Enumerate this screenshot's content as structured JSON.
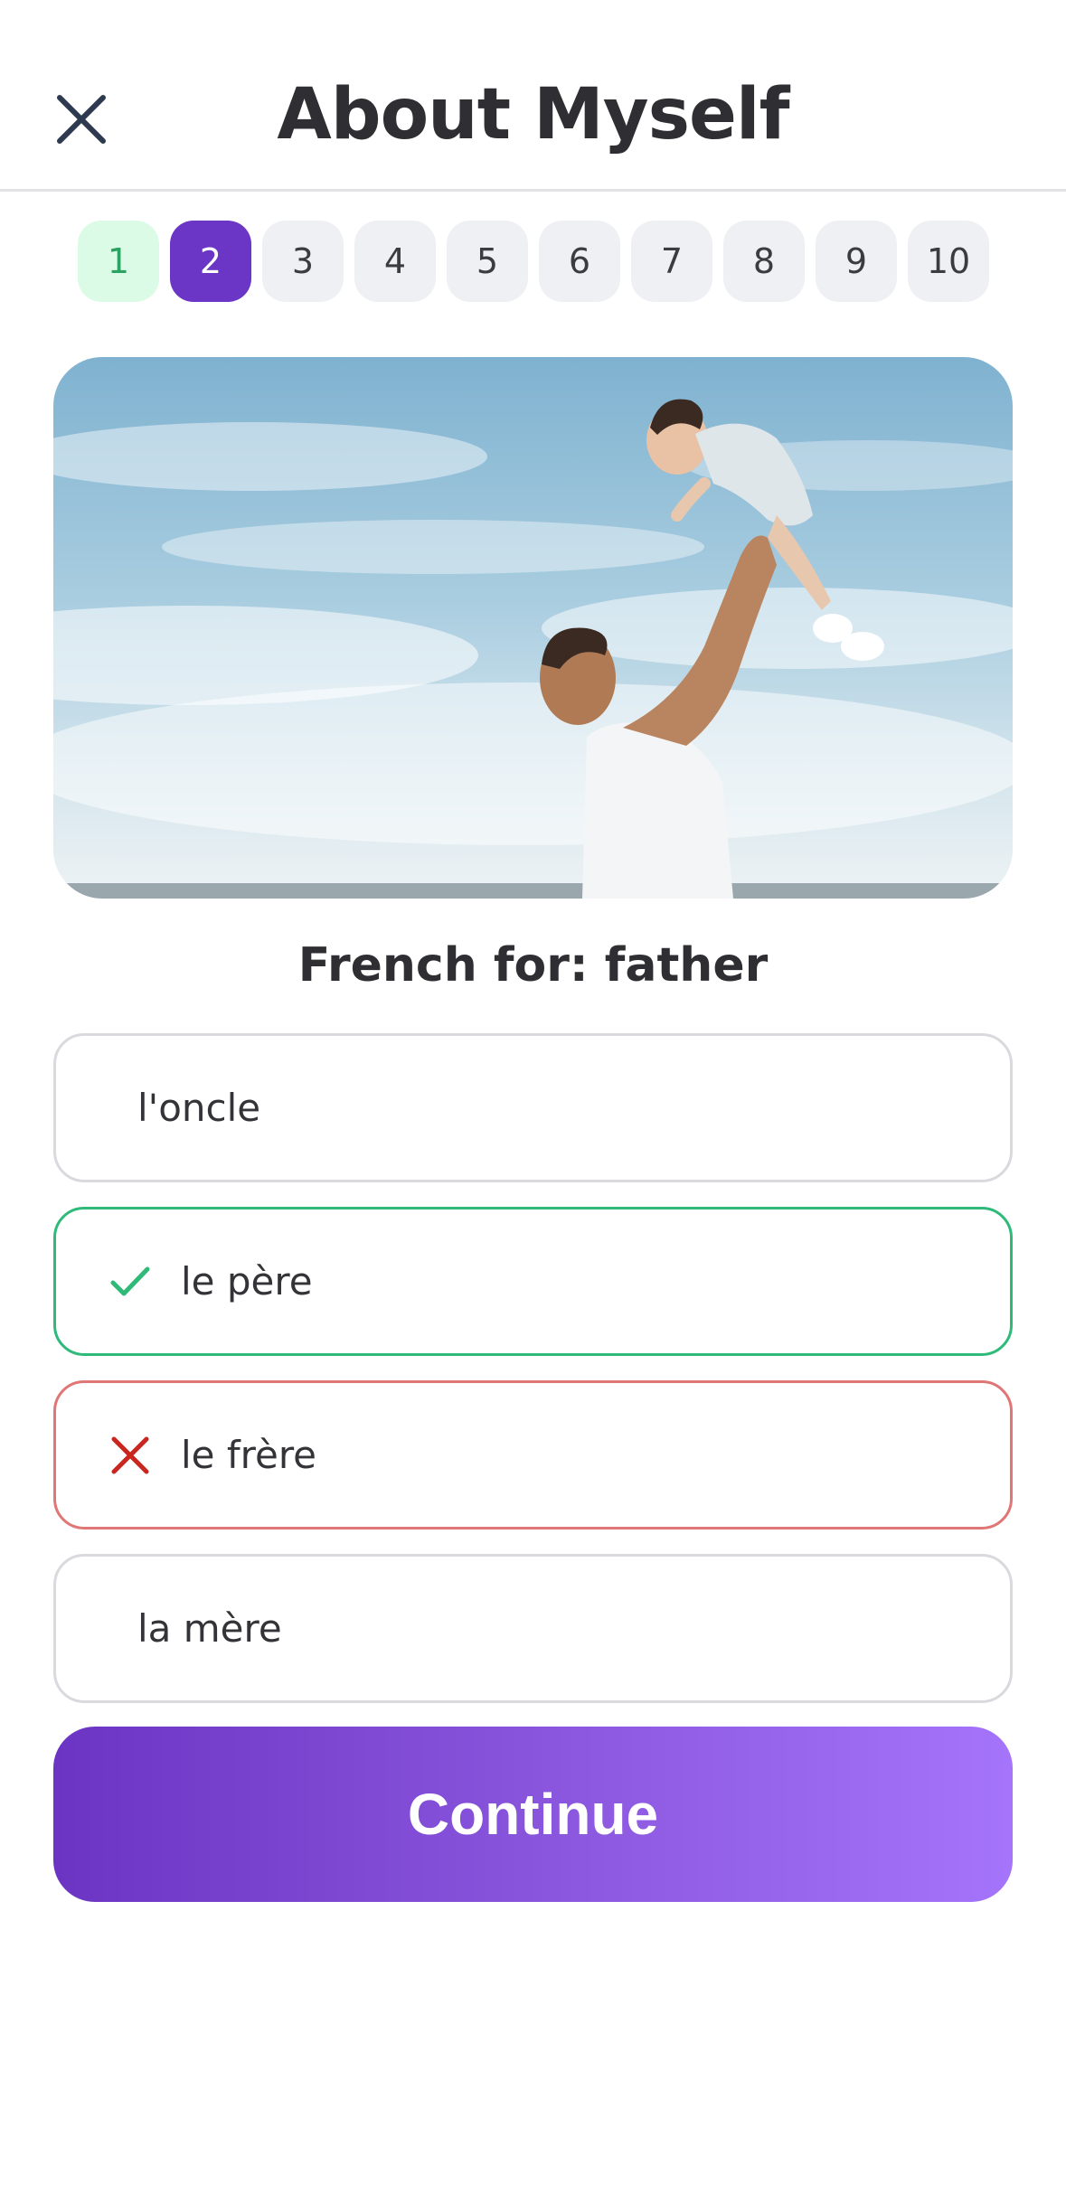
{
  "header": {
    "title": "About Myself",
    "close_icon": "close-icon"
  },
  "progress": {
    "steps": [
      "1",
      "2",
      "3",
      "4",
      "5",
      "6",
      "7",
      "8",
      "9",
      "10"
    ],
    "completed": [
      "1"
    ],
    "current": "2"
  },
  "question": {
    "prompt": "French for: father"
  },
  "options": [
    {
      "label": "l'oncle",
      "state": "neutral"
    },
    {
      "label": "le père",
      "state": "correct",
      "icon": "check-icon"
    },
    {
      "label": "le frère",
      "state": "wrong",
      "icon": "cross-icon"
    },
    {
      "label": "la mère",
      "state": "neutral"
    }
  ],
  "actions": {
    "continue_label": "Continue"
  },
  "colors": {
    "accent": "#6b35c6",
    "correct": "#2fba7a",
    "wrong": "#e07676",
    "completed_step_bg": "#dcfbe6"
  }
}
